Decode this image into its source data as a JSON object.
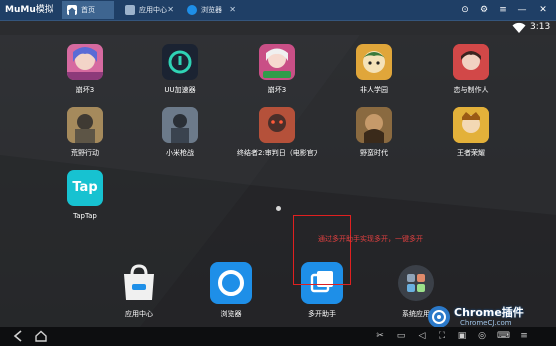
{
  "titlebar": {
    "logo": {
      "brand": "MuMu",
      "suffix": "模拟器"
    },
    "tabs": [
      {
        "label": "首页",
        "icon": "home-icon",
        "close": ""
      },
      {
        "label": "应用中心",
        "icon": "app-center-icon",
        "close": "✕"
      },
      {
        "label": "浏览器",
        "icon": "browser-icon",
        "close": "✕"
      }
    ],
    "controls": [
      {
        "name": "pin-icon",
        "glyph": "⊙"
      },
      {
        "name": "settings-icon",
        "glyph": "⚙"
      },
      {
        "name": "menu-icon",
        "glyph": "≡"
      },
      {
        "name": "minimize-icon",
        "glyph": "—"
      },
      {
        "name": "close-icon",
        "glyph": "✕"
      }
    ]
  },
  "status": {
    "time": "3:13"
  },
  "apps": [
    {
      "label": "崩坏3",
      "icon": "honkai-icon",
      "color": "#d66aa0"
    },
    {
      "label": "UU加速器",
      "icon": "uu-accelerator-icon",
      "color": "#1b2332"
    },
    {
      "label": "崩坏3",
      "icon": "honkai-icon",
      "color": "#c94f86"
    },
    {
      "label": "非人学园",
      "icon": "feiren-icon",
      "color": "#e0a63a"
    },
    {
      "label": "恋与制作人",
      "icon": "love-producer-icon",
      "color": "#c23a3a"
    },
    {
      "label": "荒野行动",
      "icon": "knives-out-icon",
      "color": "#7b6a4e"
    },
    {
      "label": "小米枪战",
      "icon": "mi-shooter-icon",
      "color": "#3c4a5f"
    },
    {
      "label": "终结者2:审判日（电影官方...",
      "icon": "terminator-icon",
      "color": "#8a3a2a"
    },
    {
      "label": "野蛮时代",
      "icon": "savage-age-icon",
      "color": "#6f5533"
    },
    {
      "label": "王者荣耀",
      "icon": "honor-of-kings-icon",
      "color": "#d59a22"
    },
    {
      "label": "TapTap",
      "icon": "taptap-icon",
      "color": "#17c2d1",
      "text": "Tap"
    }
  ],
  "dock": [
    {
      "label": "应用中心",
      "icon": "app-store-bag-icon",
      "color": "#eeeeee"
    },
    {
      "label": "浏览器",
      "icon": "browser-ring-icon",
      "color": "#1e8fe8"
    },
    {
      "label": "多开助手",
      "icon": "multi-instance-icon",
      "color": "#1e8fe8"
    },
    {
      "label": "系统应用",
      "icon": "system-apps-icon",
      "color": "#555b66"
    }
  ],
  "annotation": "通过多开助手实现多开，一键多开",
  "watermark": {
    "name": "Chrome插件",
    "url": "ChromeCJ.com"
  },
  "navbar": {
    "right_buttons": [
      {
        "name": "scissors-icon",
        "glyph": "✂"
      },
      {
        "name": "folder-icon",
        "glyph": "▭"
      },
      {
        "name": "volume-icon",
        "glyph": "◁"
      },
      {
        "name": "fullscreen-icon",
        "glyph": "⛶"
      },
      {
        "name": "screenshot-icon",
        "glyph": "▣"
      },
      {
        "name": "location-icon",
        "glyph": "◎"
      },
      {
        "name": "keyboard-icon",
        "glyph": "⌨"
      },
      {
        "name": "more-icon",
        "glyph": "≡"
      }
    ]
  }
}
